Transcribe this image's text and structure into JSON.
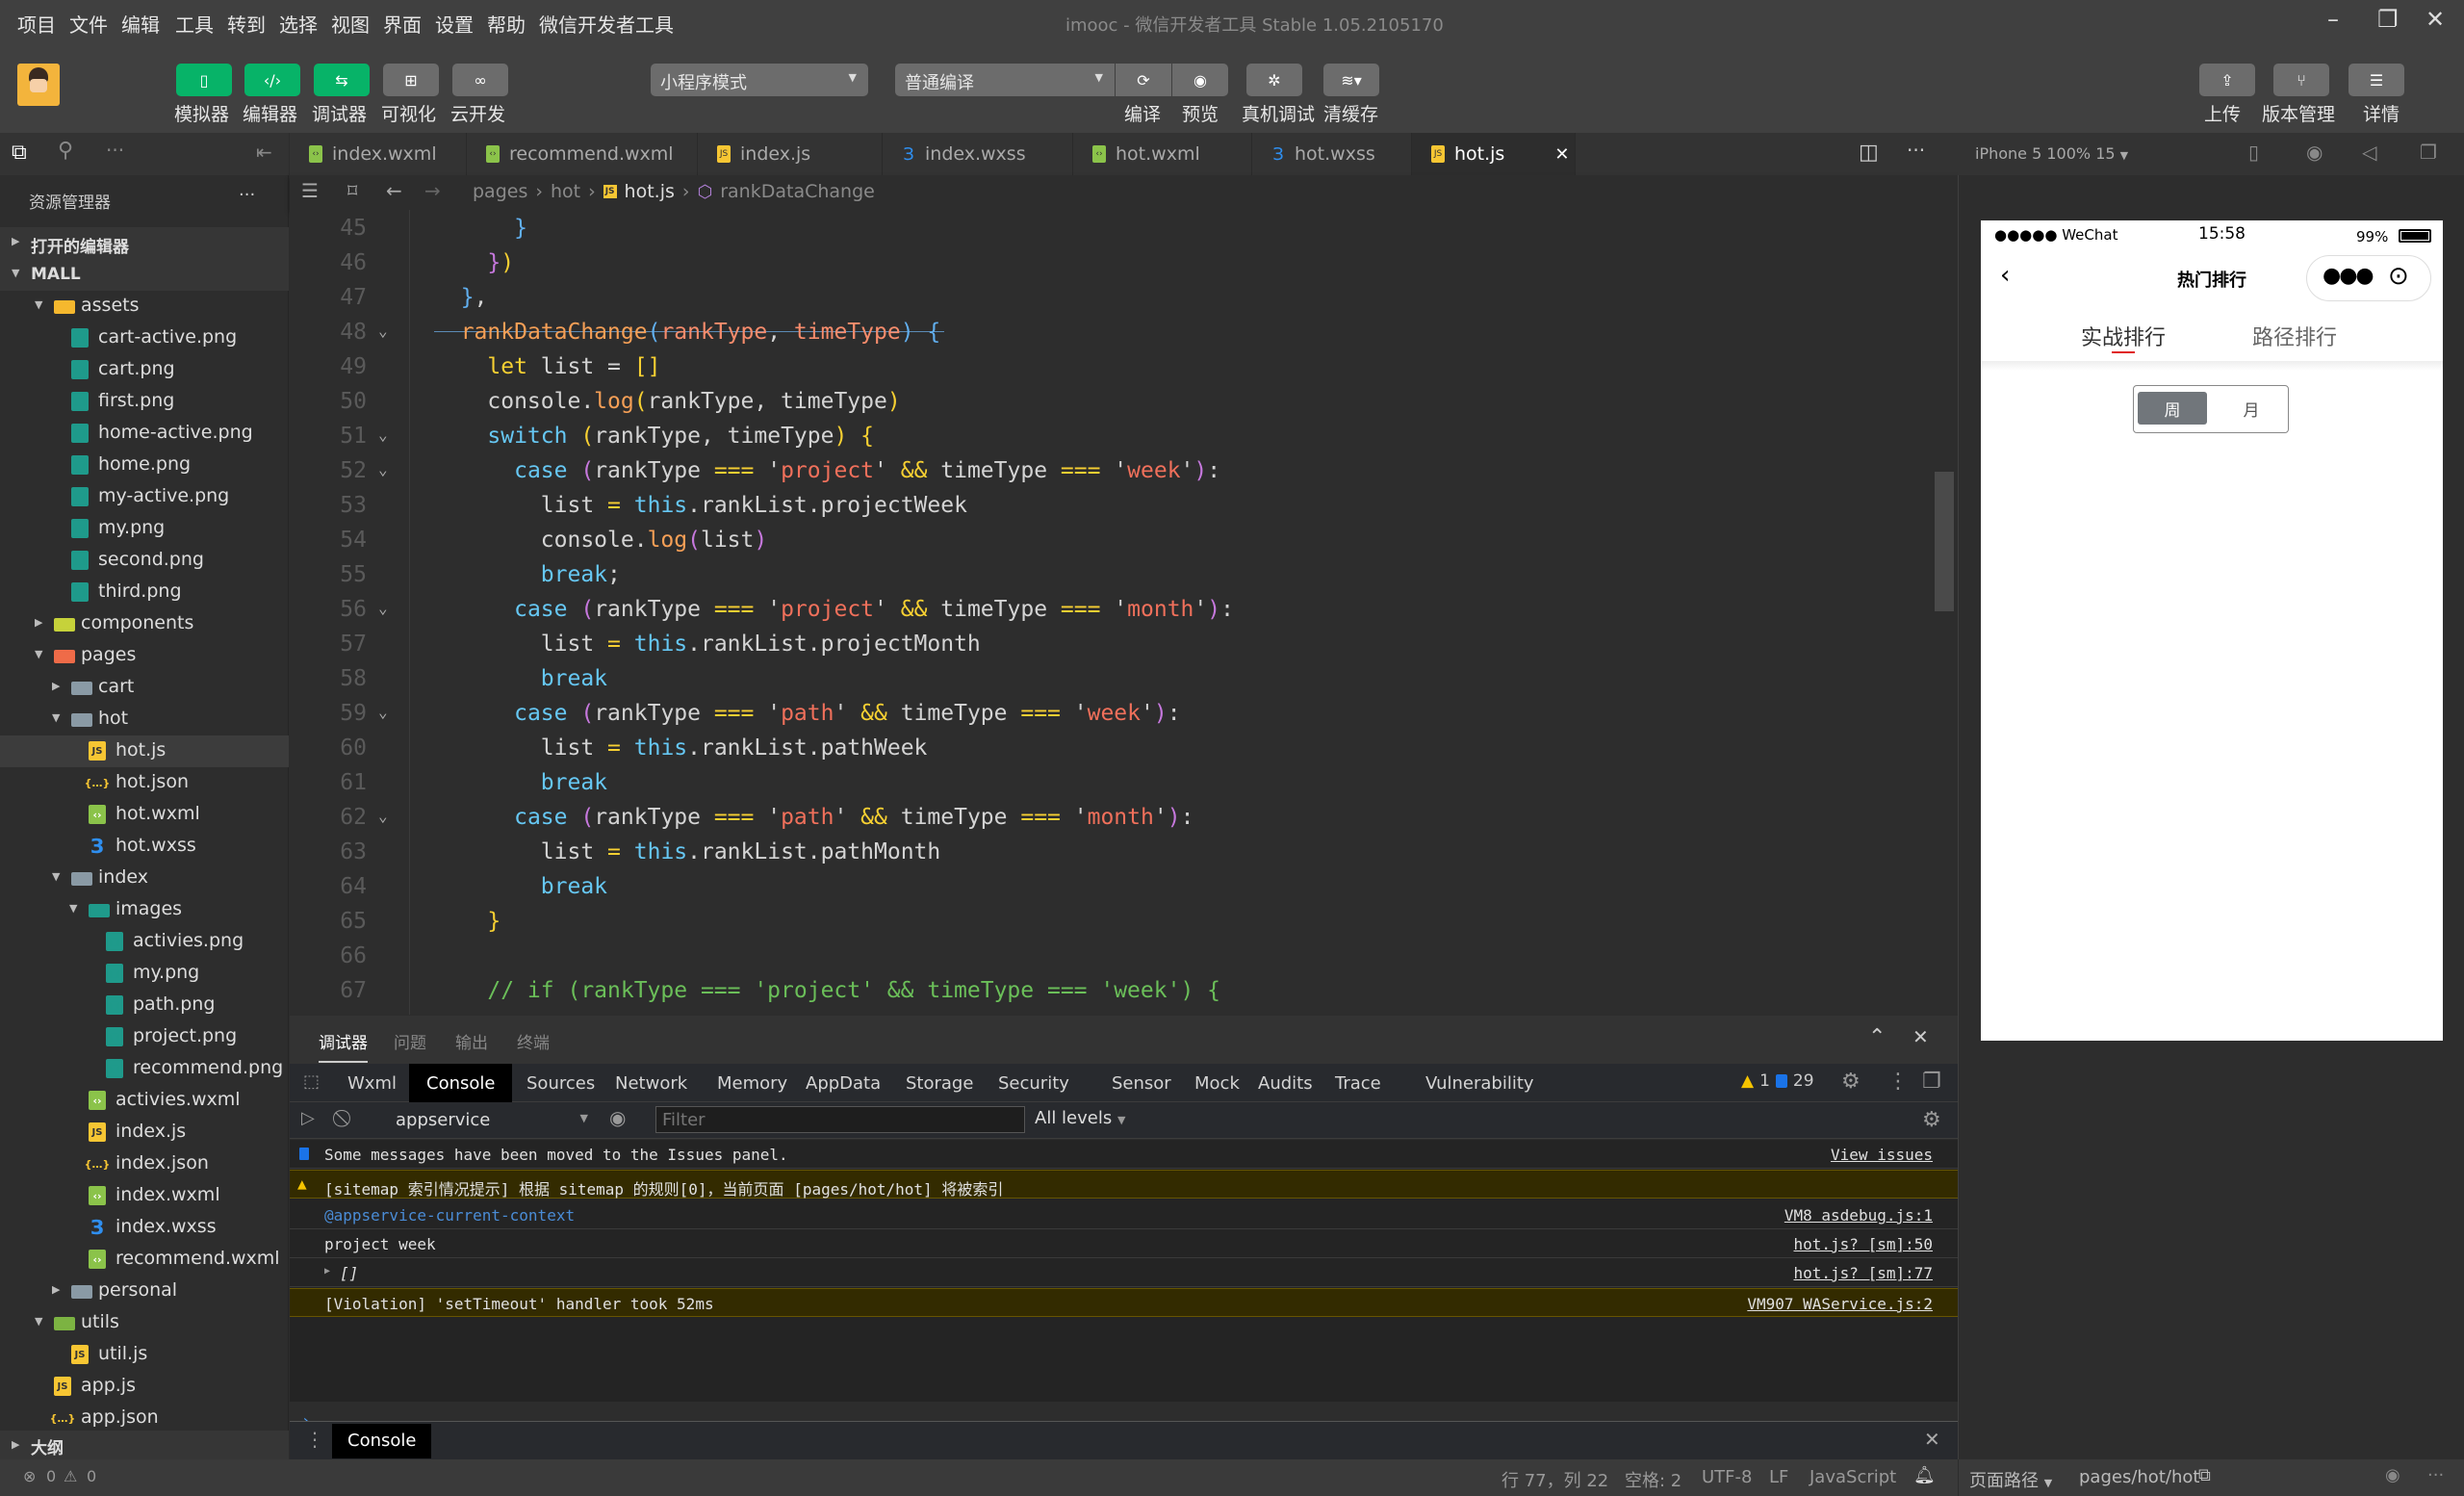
{
  "titlebar": {
    "menu": [
      "项目",
      "文件",
      "编辑",
      "工具",
      "转到",
      "选择",
      "视图",
      "界面",
      "设置",
      "帮助",
      "微信开发者工具"
    ],
    "title": "imooc - 微信开发者工具 Stable 1.05.2105170"
  },
  "toolbar": {
    "left_buttons": [
      {
        "label": "模拟器",
        "icon": "phone-icon"
      },
      {
        "label": "编辑器",
        "icon": "code-icon"
      },
      {
        "label": "调试器",
        "icon": "debug-toggle-icon"
      },
      {
        "label": "可视化",
        "icon": "layout-icon"
      },
      {
        "label": "云开发",
        "icon": "cloud-icon"
      }
    ],
    "mode_select": "小程序模式",
    "compile_select": "普通编译",
    "mid_labels": {
      "compile": "编译",
      "preview": "预览",
      "remote_debug": "真机调试",
      "clear_cache": "清缓存"
    },
    "right_buttons": [
      {
        "label": "上传",
        "icon": "upload-icon"
      },
      {
        "label": "版本管理",
        "icon": "branch-icon"
      },
      {
        "label": "详情",
        "icon": "menu-icon"
      }
    ]
  },
  "explorer": {
    "title": "资源管理器",
    "open_editors": "打开的编辑器",
    "project": "MALL",
    "outline": "大纲",
    "tree": [
      {
        "name": "assets",
        "type": "fassets",
        "depth": 1,
        "open": true
      },
      {
        "name": "cart-active.png",
        "type": "png",
        "depth": 2
      },
      {
        "name": "cart.png",
        "type": "png",
        "depth": 2
      },
      {
        "name": "first.png",
        "type": "png",
        "depth": 2
      },
      {
        "name": "home-active.png",
        "type": "png",
        "depth": 2
      },
      {
        "name": "home.png",
        "type": "png",
        "depth": 2
      },
      {
        "name": "my-active.png",
        "type": "png",
        "depth": 2
      },
      {
        "name": "my.png",
        "type": "png",
        "depth": 2
      },
      {
        "name": "second.png",
        "type": "png",
        "depth": 2
      },
      {
        "name": "third.png",
        "type": "png",
        "depth": 2
      },
      {
        "name": "components",
        "type": "fcomp",
        "depth": 1,
        "open": false
      },
      {
        "name": "pages",
        "type": "fpages",
        "depth": 1,
        "open": true
      },
      {
        "name": "cart",
        "type": "folder",
        "depth": 2,
        "open": false
      },
      {
        "name": "hot",
        "type": "folder",
        "depth": 2,
        "open": true
      },
      {
        "name": "hot.js",
        "type": "js",
        "depth": 3,
        "selected": true
      },
      {
        "name": "hot.json",
        "type": "json",
        "depth": 3
      },
      {
        "name": "hot.wxml",
        "type": "wxml",
        "depth": 3
      },
      {
        "name": "hot.wxss",
        "type": "wxss",
        "depth": 3
      },
      {
        "name": "index",
        "type": "folder",
        "depth": 2,
        "open": true
      },
      {
        "name": "images",
        "type": "fimg",
        "depth": 3,
        "open": true
      },
      {
        "name": "activies.png",
        "type": "png",
        "depth": 4
      },
      {
        "name": "my.png",
        "type": "png",
        "depth": 4
      },
      {
        "name": "path.png",
        "type": "png",
        "depth": 4
      },
      {
        "name": "project.png",
        "type": "png",
        "depth": 4
      },
      {
        "name": "recommend.png",
        "type": "png",
        "depth": 4
      },
      {
        "name": "activies.wxml",
        "type": "wxml",
        "depth": 3
      },
      {
        "name": "index.js",
        "type": "js",
        "depth": 3
      },
      {
        "name": "index.json",
        "type": "json",
        "depth": 3
      },
      {
        "name": "index.wxml",
        "type": "wxml",
        "depth": 3
      },
      {
        "name": "index.wxss",
        "type": "wxss",
        "depth": 3
      },
      {
        "name": "recommend.wxml",
        "type": "wxml",
        "depth": 3
      },
      {
        "name": "personal",
        "type": "folder",
        "depth": 2,
        "open": false
      },
      {
        "name": "utils",
        "type": "futil",
        "depth": 1,
        "open": true
      },
      {
        "name": "util.js",
        "type": "js",
        "depth": 2
      },
      {
        "name": "app.js",
        "type": "js",
        "depth": 1
      },
      {
        "name": "app.json",
        "type": "json",
        "depth": 1
      }
    ],
    "errors": "0",
    "warnings": "0"
  },
  "editor": {
    "tabs": [
      {
        "label": "index.wxml",
        "type": "wxml"
      },
      {
        "label": "recommend.wxml",
        "type": "wxml"
      },
      {
        "label": "index.js",
        "type": "js"
      },
      {
        "label": "index.wxss",
        "type": "wxss"
      },
      {
        "label": "hot.wxml",
        "type": "wxml"
      },
      {
        "label": "hot.wxss",
        "type": "wxss"
      },
      {
        "label": "hot.js",
        "type": "js",
        "active": true
      }
    ],
    "breadcrumb": [
      "pages",
      "hot",
      "hot.js",
      "rankDataChange"
    ],
    "lines": [
      {
        "n": 45,
        "fold": false,
        "html": "      <span class='b'>}</span>"
      },
      {
        "n": 46,
        "fold": false,
        "html": "    <span class='m'>}</span><span class='y'>)</span>"
      },
      {
        "n": 47,
        "fold": false,
        "html": "  <span class='b'>}</span><span class='t'>,</span>"
      },
      {
        "n": 48,
        "fold": true,
        "html": "  <span class='f'>rankDataChange</span><span class='b'>(</span><span class='p'>rankType</span><span class='t'>, </span><span class='p'>timeType</span><span class='b'>)</span><span class='t'> </span><span class='b'>{</span>"
      },
      {
        "n": 49,
        "fold": false,
        "html": "    <span class='y'>let</span><span class='t'> list = </span><span class='y'>[]</span>"
      },
      {
        "n": 50,
        "fold": false,
        "html": "    <span class='t'>console.</span><span class='f'>log</span><span class='y'>(</span><span class='t'>rankType, timeType</span><span class='y'>)</span>"
      },
      {
        "n": 51,
        "fold": true,
        "html": "    <span class='k'>switch</span><span class='t'> </span><span class='y'>(</span><span class='t'>rankType, timeType</span><span class='y'>)</span><span class='t'> </span><span class='y'>{</span>"
      },
      {
        "n": 52,
        "fold": true,
        "html": "      <span class='k'>case</span><span class='t'> </span><span class='m'>(</span><span class='t'>rankType </span><span class='y'>===</span><span class='t'> '</span><span class='s'>project</span><span class='t'>' </span><span class='y'>&amp;&amp;</span><span class='t'> timeType </span><span class='y'>===</span><span class='t'> '</span><span class='s'>week</span><span class='t'>'</span><span class='m'>)</span><span class='t'>:</span>"
      },
      {
        "n": 53,
        "fold": false,
        "html": "        <span class='t'>list </span><span class='y'>=</span><span class='t'> </span><span class='k'>this</span><span class='t'>.rankList.projectWeek</span>"
      },
      {
        "n": 54,
        "fold": false,
        "html": "        <span class='t'>console.</span><span class='f'>log</span><span class='m'>(</span><span class='t'>list</span><span class='m'>)</span>"
      },
      {
        "n": 55,
        "fold": false,
        "html": "        <span class='k'>break</span><span class='t'>;</span>"
      },
      {
        "n": 56,
        "fold": true,
        "html": "      <span class='k'>case</span><span class='t'> </span><span class='m'>(</span><span class='t'>rankType </span><span class='y'>===</span><span class='t'> '</span><span class='s'>project</span><span class='t'>' </span><span class='y'>&amp;&amp;</span><span class='t'> timeType </span><span class='y'>===</span><span class='t'> '</span><span class='s'>month</span><span class='t'>'</span><span class='m'>)</span><span class='t'>:</span>"
      },
      {
        "n": 57,
        "fold": false,
        "html": "        <span class='t'>list </span><span class='y'>=</span><span class='t'> </span><span class='k'>this</span><span class='t'>.rankList.projectMonth</span>"
      },
      {
        "n": 58,
        "fold": false,
        "html": "        <span class='k'>break</span>"
      },
      {
        "n": 59,
        "fold": true,
        "html": "      <span class='k'>case</span><span class='t'> </span><span class='m'>(</span><span class='t'>rankType </span><span class='y'>===</span><span class='t'> '</span><span class='s'>path</span><span class='t'>' </span><span class='y'>&amp;&amp;</span><span class='t'> timeType </span><span class='y'>===</span><span class='t'> '</span><span class='s'>week</span><span class='t'>'</span><span class='m'>)</span><span class='t'>:</span>"
      },
      {
        "n": 60,
        "fold": false,
        "html": "        <span class='t'>list </span><span class='y'>=</span><span class='t'> </span><span class='k'>this</span><span class='t'>.rankList.pathWeek</span>"
      },
      {
        "n": 61,
        "fold": false,
        "html": "        <span class='k'>break</span>"
      },
      {
        "n": 62,
        "fold": true,
        "html": "      <span class='k'>case</span><span class='t'> </span><span class='m'>(</span><span class='t'>rankType </span><span class='y'>===</span><span class='t'> '</span><span class='s'>path</span><span class='t'>' </span><span class='y'>&amp;&amp;</span><span class='t'> timeType </span><span class='y'>===</span><span class='t'> '</span><span class='s'>month</span><span class='t'>'</span><span class='m'>)</span><span class='t'>:</span>"
      },
      {
        "n": 63,
        "fold": false,
        "html": "        <span class='t'>list </span><span class='y'>=</span><span class='t'> </span><span class='k'>this</span><span class='t'>.rankList.pathMonth</span>"
      },
      {
        "n": 64,
        "fold": false,
        "html": "        <span class='k'>break</span>"
      },
      {
        "n": 65,
        "fold": false,
        "html": "    <span class='y'>}</span>"
      },
      {
        "n": 66,
        "fold": false,
        "html": ""
      },
      {
        "n": 67,
        "fold": false,
        "html": "    <span class='c'>// if (rankType === 'project' &amp;&amp; timeType === 'week') {</span>"
      }
    ]
  },
  "devtools": {
    "panel_tabs": [
      "调试器",
      "问题",
      "输出",
      "终端"
    ],
    "tabs": [
      "Wxml",
      "Console",
      "Sources",
      "Network",
      "Memory",
      "AppData",
      "Storage",
      "Security",
      "Sensor",
      "Mock",
      "Audits",
      "Trace",
      "Vulnerability"
    ],
    "active_tab": "Console",
    "warn_count": "1",
    "info_count": "29",
    "context": "appservice",
    "filter_placeholder": "Filter",
    "levels": "All levels",
    "messages": [
      {
        "text": "Some messages have been moved to the Issues panel.",
        "source": "View issues",
        "kind": "info"
      },
      {
        "text": "[sitemap 索引情况提示] 根据 sitemap 的规则[0]，当前页面 [pages/hot/hot] 将被索引",
        "source": "",
        "kind": "warn"
      },
      {
        "text": "@appservice-current-context",
        "source": "VM8 asdebug.js:1",
        "kind": "context"
      },
      {
        "text": "project week",
        "source": "hot.js? [sm]:50",
        "kind": "log"
      },
      {
        "text": "[]",
        "source": "hot.js? [sm]:77",
        "kind": "array"
      },
      {
        "text": "[Violation] 'setTimeout' handler took 52ms",
        "source": "VM907 WAService.js:2",
        "kind": "violation"
      }
    ],
    "drawer_tab": "Console"
  },
  "statusbar": {
    "position": "行 77，列 22",
    "indent": "空格: 2",
    "encoding": "UTF-8",
    "eol": "LF",
    "language": "JavaScript",
    "page_path_label": "页面路径",
    "page_path": "pages/hot/hot"
  },
  "simulator": {
    "device": "iPhone 5 100% 15",
    "status": {
      "carrier": "●●●●● WeChat",
      "time": "15:58",
      "battery": "99%"
    },
    "nav_title": "热门排行",
    "tabs": [
      {
        "label": "实战排行",
        "active": true
      },
      {
        "label": "路径排行",
        "active": false
      }
    ],
    "segments": [
      {
        "label": "周",
        "active": true
      },
      {
        "label": "月",
        "active": false
      }
    ],
    "accent": "#e02020"
  }
}
